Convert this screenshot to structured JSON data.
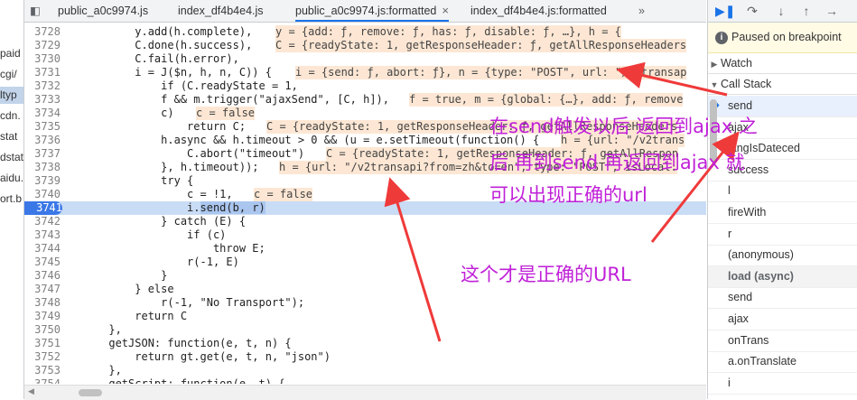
{
  "navigator": {
    "items": [
      {
        "label": "paid"
      },
      {
        "label": "cgi/"
      },
      {
        "label": "ltyp",
        "selected": true
      },
      {
        "label": "cdn."
      },
      {
        "label": "stat"
      },
      {
        "label": "dstat"
      },
      {
        "label": "aidu."
      },
      {
        "label": "ort.b"
      }
    ]
  },
  "tabs": [
    {
      "label": "public_a0c9974.js"
    },
    {
      "label": "index_df4b4e4.js"
    },
    {
      "label": "public_a0c9974.js:formatted",
      "active": true,
      "close": "×"
    },
    {
      "label": "index_df4b4e4.js:formatted"
    },
    {
      "label": "»"
    }
  ],
  "code": {
    "lines": [
      {
        "n": "3728",
        "text": "          y.add(h.complete),",
        "inline": "y = {add: ƒ, remove: ƒ, has: ƒ, disable: ƒ, …}, h = {"
      },
      {
        "n": "3729",
        "text": "          C.done(h.success),",
        "inline": "C = {readyState: 1, getResponseHeader: ƒ, getAllResponseHeaders"
      },
      {
        "n": "3730",
        "text": "          C.fail(h.error),",
        "inline": ""
      },
      {
        "n": "3731",
        "text": "          i = J($n, h, n, C)) {",
        "inline": "i = {send: ƒ, abort: ƒ}, n = {type: \"POST\", url: \"/v2transap"
      },
      {
        "n": "3732",
        "text": "              if (C.readyState = 1,",
        "inline": ""
      },
      {
        "n": "3733",
        "text": "              f && m.trigger(\"ajaxSend\", [C, h]),",
        "inline": "f = true, m = {global: {…}, add: ƒ, remove"
      },
      {
        "n": "3734",
        "text": "              c)",
        "inline": "c = false"
      },
      {
        "n": "3735",
        "text": "                  return C;",
        "inline": "C = {readyState: 1, getResponseHeader: ƒ, getAllResponseHeaders"
      },
      {
        "n": "3736",
        "text": "              h.async && h.timeout > 0 && (u = e.setTimeout(function() {",
        "inline": "h = {url: \"/v2trans"
      },
      {
        "n": "3737",
        "text": "                  C.abort(\"timeout\")",
        "inline": "C = {readyState: 1, getResponseHeader: ƒ, getAllRespon"
      },
      {
        "n": "3738",
        "text": "              }, h.timeout));",
        "inline": "h = {url: \"/v2transapi?from=zh&to=en\", type: \"POST\", isLocal:"
      },
      {
        "n": "3739",
        "text": "              try {",
        "inline": ""
      },
      {
        "n": "3740",
        "text": "                  c = !1,",
        "inline": "c = false"
      },
      {
        "n": "3741",
        "text": "                  i.send(b, r)",
        "inline": "",
        "highlight": true
      },
      {
        "n": "3742",
        "text": "              } catch (E) {",
        "inline": ""
      },
      {
        "n": "3743",
        "text": "                  if (c)",
        "inline": ""
      },
      {
        "n": "3744",
        "text": "                      throw E;",
        "inline": ""
      },
      {
        "n": "3745",
        "text": "                  r(-1, E)",
        "inline": ""
      },
      {
        "n": "3746",
        "text": "              }",
        "inline": ""
      },
      {
        "n": "3747",
        "text": "          } else",
        "inline": ""
      },
      {
        "n": "3748",
        "text": "              r(-1, \"No Transport\");",
        "inline": ""
      },
      {
        "n": "3749",
        "text": "          return C",
        "inline": ""
      },
      {
        "n": "3750",
        "text": "      },",
        "inline": ""
      },
      {
        "n": "3751",
        "text": "      getJSON: function(e, t, n) {",
        "inline": ""
      },
      {
        "n": "3752",
        "text": "          return gt.get(e, t, n, \"json\")",
        "inline": ""
      },
      {
        "n": "3753",
        "text": "      },",
        "inline": ""
      },
      {
        "n": "3754",
        "text": "      getScript: function(e, t) {",
        "inline": ""
      }
    ]
  },
  "right_panel": {
    "toolbar": [
      "resume-icon",
      "step-over-icon",
      "step-into-icon",
      "step-out-icon",
      "step-icon"
    ],
    "paused_text": "Paused on breakpoint",
    "watch_label": "Watch",
    "call_stack_label": "Call Stack",
    "frames": [
      {
        "label": "send",
        "current": true
      },
      {
        "label": "ajax"
      },
      {
        "label": "langIsDateced"
      },
      {
        "label": "success"
      },
      {
        "label": "l"
      },
      {
        "label": "fireWith"
      },
      {
        "label": "r"
      },
      {
        "label": "(anonymous)"
      },
      {
        "label": "load (async)",
        "async": true
      },
      {
        "label": "send"
      },
      {
        "label": "ajax"
      },
      {
        "label": "onTrans"
      },
      {
        "label": "a.onTranslate"
      },
      {
        "label": "i"
      }
    ]
  },
  "annotations": {
    "note1_line1": "在send触发以后 返回到ajax 之",
    "note1_line2": "后 再到send 再返回到ajax 就",
    "note1_line3": "可以出现正确的url",
    "note2": "这个才是正确的URL",
    "color": "#c020d8",
    "arrow_color": "#ef3a3a"
  }
}
